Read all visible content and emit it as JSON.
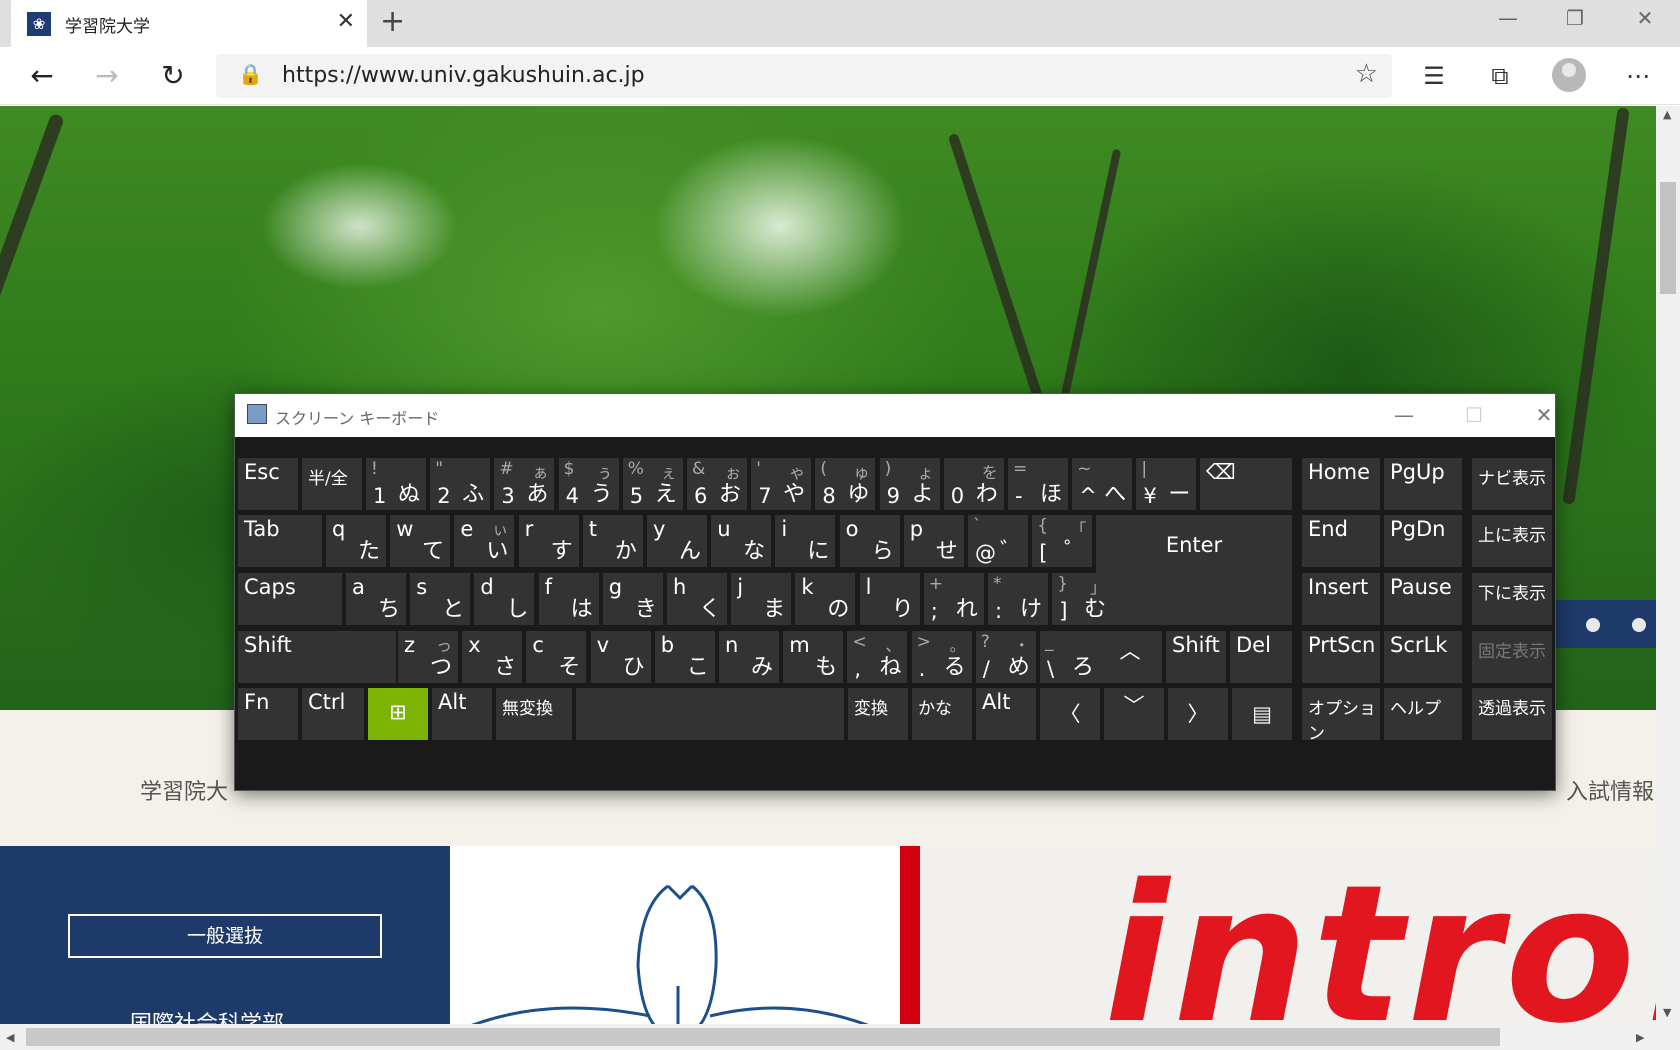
{
  "browser": {
    "tab_title": "学習院大学",
    "favicon": "❀",
    "url": "https://www.univ.gakushuin.ac.jp"
  },
  "page": {
    "gnav_left": "学習院大",
    "gnav_right": "入試情報",
    "panel_button": "一般選抜",
    "panel_text": "国際社会科学部",
    "intro_logo": "intro!"
  },
  "osk": {
    "title": "スクリーン キーボード",
    "rows": {
      "r1": [
        {
          "l": "Esc"
        },
        {
          "l": "半/全"
        },
        {
          "s": "!",
          "b": "1",
          "j": "ぬ"
        },
        {
          "s": "\"",
          "b": "2",
          "j": "ふ"
        },
        {
          "s": "#",
          "k": "ぁ",
          "b": "3",
          "j": "あ"
        },
        {
          "s": "$",
          "k": "ぅ",
          "b": "4",
          "j": "う"
        },
        {
          "s": "%",
          "k": "ぇ",
          "b": "5",
          "j": "え"
        },
        {
          "s": "&",
          "k": "ぉ",
          "b": "6",
          "j": "お"
        },
        {
          "s": "'",
          "k": "ゃ",
          "b": "7",
          "j": "や"
        },
        {
          "s": "(",
          "k": "ゅ",
          "b": "8",
          "j": "ゆ"
        },
        {
          "s": ")",
          "k": "ょ",
          "b": "9",
          "j": "よ"
        },
        {
          "k": "を",
          "b": "0",
          "j": "わ"
        },
        {
          "s": "=",
          "b": "-",
          "j": "ほ"
        },
        {
          "s": "~",
          "b": "^",
          "j": "へ"
        },
        {
          "s": "|",
          "b": "¥",
          "j": "ー"
        }
      ],
      "r2": [
        {
          "l": "Tab"
        },
        {
          "s": "q",
          "j": "た"
        },
        {
          "s": "w",
          "j": "て"
        },
        {
          "s": "e",
          "k": "ぃ",
          "j": "い"
        },
        {
          "s": "r",
          "j": "す"
        },
        {
          "s": "t",
          "j": "か"
        },
        {
          "s": "y",
          "j": "ん"
        },
        {
          "s": "u",
          "j": "な"
        },
        {
          "s": "i",
          "j": "に"
        },
        {
          "s": "o",
          "j": "ら"
        },
        {
          "s": "p",
          "j": "せ"
        },
        {
          "s": "`",
          "b": "@",
          "j": "゛"
        },
        {
          "s": "{",
          "k": "「",
          "b": "[",
          "j": "゜"
        }
      ],
      "r3": [
        {
          "l": "Caps"
        },
        {
          "s": "a",
          "j": "ち"
        },
        {
          "s": "s",
          "j": "と"
        },
        {
          "s": "d",
          "j": "し"
        },
        {
          "s": "f",
          "j": "は"
        },
        {
          "s": "g",
          "j": "き"
        },
        {
          "s": "h",
          "j": "く"
        },
        {
          "s": "j",
          "j": "ま"
        },
        {
          "s": "k",
          "j": "の"
        },
        {
          "s": "l",
          "j": "り"
        },
        {
          "s": "+",
          "b": ";",
          "j": "れ"
        },
        {
          "s": "*",
          "b": ":",
          "j": "け"
        },
        {
          "s": "}",
          "k": "」",
          "b": "]",
          "j": "む"
        }
      ],
      "r4": [
        {
          "l": "Shift"
        },
        {
          "s": "z",
          "k": "っ",
          "j": "つ"
        },
        {
          "s": "x",
          "j": "さ"
        },
        {
          "s": "c",
          "j": "そ"
        },
        {
          "s": "v",
          "j": "ひ"
        },
        {
          "s": "b",
          "j": "こ"
        },
        {
          "s": "n",
          "j": "み"
        },
        {
          "s": "m",
          "j": "も"
        },
        {
          "s": "<",
          "k": "、",
          "b": ",",
          "j": "ね"
        },
        {
          "s": ">",
          "k": "。",
          "b": ".",
          "j": "る"
        },
        {
          "s": "?",
          "k": "・",
          "b": "/",
          "j": "め"
        },
        {
          "s": "_",
          "b": "\\",
          "j": "ろ"
        }
      ]
    },
    "keys": {
      "backspace": "⌫",
      "enter": "Enter",
      "up": "︿",
      "shift_right": "Shift",
      "del": "Del",
      "fn": "Fn",
      "ctrl": "Ctrl",
      "win": "⊞",
      "alt": "Alt",
      "muhenkan": "無変換",
      "henkan": "変換",
      "kana": "かな",
      "alt_right": "Alt",
      "left": "〈",
      "down": "﹀",
      "right": "〉",
      "menu": "▤",
      "home": "Home",
      "pgup": "PgUp",
      "navi": "ナビ表示",
      "end": "End",
      "pgdn": "PgDn",
      "move_up": "上に表示",
      "insert": "Insert",
      "pause": "Pause",
      "move_down": "下に表示",
      "prtscn": "PrtScn",
      "scrlk": "ScrLk",
      "dock": "固定表示",
      "options": "オプション",
      "help": "ヘルプ",
      "fade": "透過表示"
    }
  },
  "icons": {
    "back": "←",
    "forward": "→",
    "refresh": "↻",
    "lock": "🔒",
    "star": "☆",
    "favorites": "☰",
    "collections": "⧉",
    "more": "⋯",
    "minimize": "—",
    "maximize": "❐",
    "close": "✕",
    "new_tab": "+"
  }
}
